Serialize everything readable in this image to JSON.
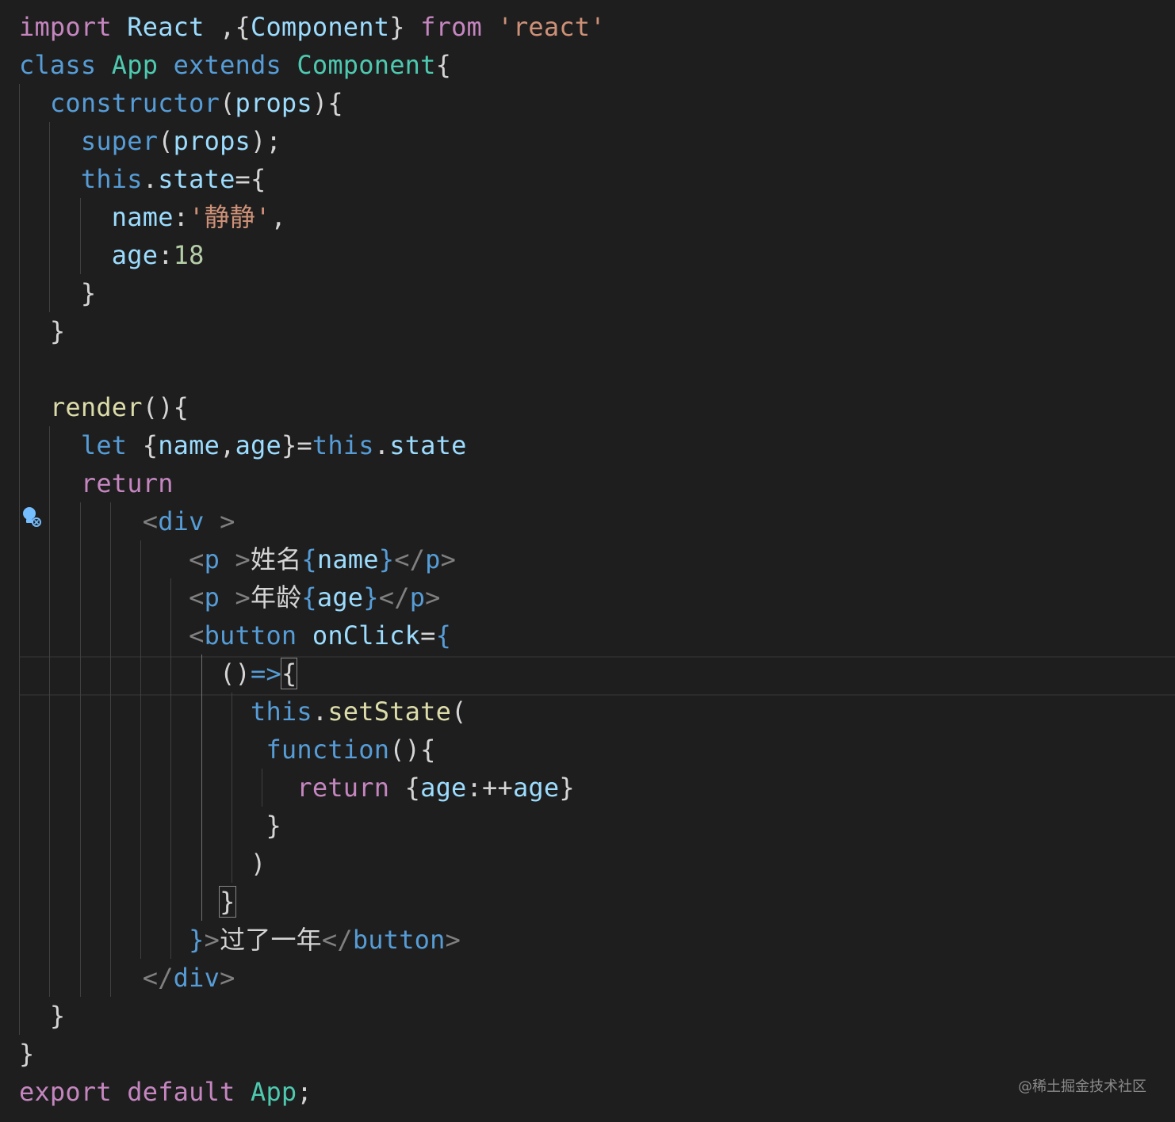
{
  "editor": {
    "lines": [
      [
        {
          "t": "import",
          "c": "kw-ctrl"
        },
        {
          "t": " "
        },
        {
          "t": "React",
          "c": "var"
        },
        {
          "t": " ,{"
        },
        {
          "t": "Component",
          "c": "var"
        },
        {
          "t": "} "
        },
        {
          "t": "from",
          "c": "kw-ctrl"
        },
        {
          "t": " "
        },
        {
          "t": "'react'",
          "c": "str"
        }
      ],
      [
        {
          "t": "class",
          "c": "kw"
        },
        {
          "t": " "
        },
        {
          "t": "App",
          "c": "cls"
        },
        {
          "t": " "
        },
        {
          "t": "extends",
          "c": "kw"
        },
        {
          "t": " "
        },
        {
          "t": "Component",
          "c": "cls"
        },
        {
          "t": "{"
        }
      ],
      [
        {
          "t": "  "
        },
        {
          "t": "constructor",
          "c": "kw"
        },
        {
          "t": "("
        },
        {
          "t": "props",
          "c": "var"
        },
        {
          "t": "){"
        }
      ],
      [
        {
          "t": "    "
        },
        {
          "t": "super",
          "c": "kw"
        },
        {
          "t": "("
        },
        {
          "t": "props",
          "c": "var"
        },
        {
          "t": ");"
        }
      ],
      [
        {
          "t": "    "
        },
        {
          "t": "this",
          "c": "kw"
        },
        {
          "t": "."
        },
        {
          "t": "state",
          "c": "var"
        },
        {
          "t": "={"
        }
      ],
      [
        {
          "t": "      "
        },
        {
          "t": "name",
          "c": "var"
        },
        {
          "t": ":"
        },
        {
          "t": "'静静'",
          "c": "str"
        },
        {
          "t": ","
        }
      ],
      [
        {
          "t": "      "
        },
        {
          "t": "age",
          "c": "var"
        },
        {
          "t": ":"
        },
        {
          "t": "18",
          "c": "num"
        }
      ],
      [
        {
          "t": "    }"
        }
      ],
      [
        {
          "t": "  }"
        }
      ],
      [
        {
          "t": ""
        }
      ],
      [
        {
          "t": "  "
        },
        {
          "t": "render",
          "c": "fn"
        },
        {
          "t": "(){"
        }
      ],
      [
        {
          "t": "    "
        },
        {
          "t": "let",
          "c": "kw"
        },
        {
          "t": " {"
        },
        {
          "t": "name",
          "c": "var"
        },
        {
          "t": ","
        },
        {
          "t": "age",
          "c": "var"
        },
        {
          "t": "}="
        },
        {
          "t": "this",
          "c": "kw"
        },
        {
          "t": "."
        },
        {
          "t": "state",
          "c": "var"
        }
      ],
      [
        {
          "t": "    "
        },
        {
          "t": "return",
          "c": "kw-ctrl"
        }
      ],
      [
        {
          "t": "        "
        },
        {
          "t": "<",
          "c": "punc-tag"
        },
        {
          "t": "div",
          "c": "tag"
        },
        {
          "t": " >",
          "c": "punc-tag"
        }
      ],
      [
        {
          "t": "           "
        },
        {
          "t": "<",
          "c": "punc-tag"
        },
        {
          "t": "p",
          "c": "tag"
        },
        {
          "t": " >",
          "c": "punc-tag"
        },
        {
          "t": "姓名"
        },
        {
          "t": "{",
          "c": "kw"
        },
        {
          "t": "name",
          "c": "var"
        },
        {
          "t": "}",
          "c": "kw"
        },
        {
          "t": "</",
          "c": "punc-tag"
        },
        {
          "t": "p",
          "c": "tag"
        },
        {
          "t": ">",
          "c": "punc-tag"
        }
      ],
      [
        {
          "t": "           "
        },
        {
          "t": "<",
          "c": "punc-tag"
        },
        {
          "t": "p",
          "c": "tag"
        },
        {
          "t": " >",
          "c": "punc-tag"
        },
        {
          "t": "年龄"
        },
        {
          "t": "{",
          "c": "kw"
        },
        {
          "t": "age",
          "c": "var"
        },
        {
          "t": "}",
          "c": "kw"
        },
        {
          "t": "</",
          "c": "punc-tag"
        },
        {
          "t": "p",
          "c": "tag"
        },
        {
          "t": ">",
          "c": "punc-tag"
        }
      ],
      [
        {
          "t": "           "
        },
        {
          "t": "<",
          "c": "punc-tag"
        },
        {
          "t": "button",
          "c": "tag"
        },
        {
          "t": " "
        },
        {
          "t": "onClick",
          "c": "var"
        },
        {
          "t": "="
        },
        {
          "t": "{",
          "c": "kw"
        }
      ],
      [
        {
          "t": "             "
        },
        {
          "t": "()"
        },
        {
          "t": "=>",
          "c": "kw"
        },
        {
          "t": "{",
          "c": "bmatch"
        }
      ],
      [
        {
          "t": "               "
        },
        {
          "t": "this",
          "c": "kw"
        },
        {
          "t": "."
        },
        {
          "t": "setState",
          "c": "fn"
        },
        {
          "t": "("
        }
      ],
      [
        {
          "t": "                "
        },
        {
          "t": "function",
          "c": "kw"
        },
        {
          "t": "(){"
        }
      ],
      [
        {
          "t": "                  "
        },
        {
          "t": "return",
          "c": "kw-ctrl"
        },
        {
          "t": " {"
        },
        {
          "t": "age",
          "c": "var"
        },
        {
          "t": ":++"
        },
        {
          "t": "age",
          "c": "var"
        },
        {
          "t": "}"
        }
      ],
      [
        {
          "t": "                }"
        }
      ],
      [
        {
          "t": "               )"
        }
      ],
      [
        {
          "t": "             "
        },
        {
          "t": "}",
          "c": "bmatch"
        }
      ],
      [
        {
          "t": "           "
        },
        {
          "t": "}",
          "c": "kw"
        },
        {
          "t": ">",
          "c": "punc-tag"
        },
        {
          "t": "过了一年"
        },
        {
          "t": "</",
          "c": "punc-tag"
        },
        {
          "t": "button",
          "c": "tag"
        },
        {
          "t": ">",
          "c": "punc-tag"
        }
      ],
      [
        {
          "t": "        "
        },
        {
          "t": "</",
          "c": "punc-tag"
        },
        {
          "t": "div",
          "c": "tag"
        },
        {
          "t": ">",
          "c": "punc-tag"
        }
      ],
      [
        {
          "t": "  }"
        }
      ],
      [
        {
          "t": "}"
        }
      ],
      [
        {
          "t": "export",
          "c": "kw-ctrl"
        },
        {
          "t": " "
        },
        {
          "t": "default",
          "c": "kw-ctrl"
        },
        {
          "t": " "
        },
        {
          "t": "App",
          "c": "cls"
        },
        {
          "t": ";"
        }
      ]
    ]
  },
  "lightbulb": {
    "icon": "lightbulb-icon",
    "color": "#75beff"
  },
  "watermark": "@稀土掘金技术社区"
}
